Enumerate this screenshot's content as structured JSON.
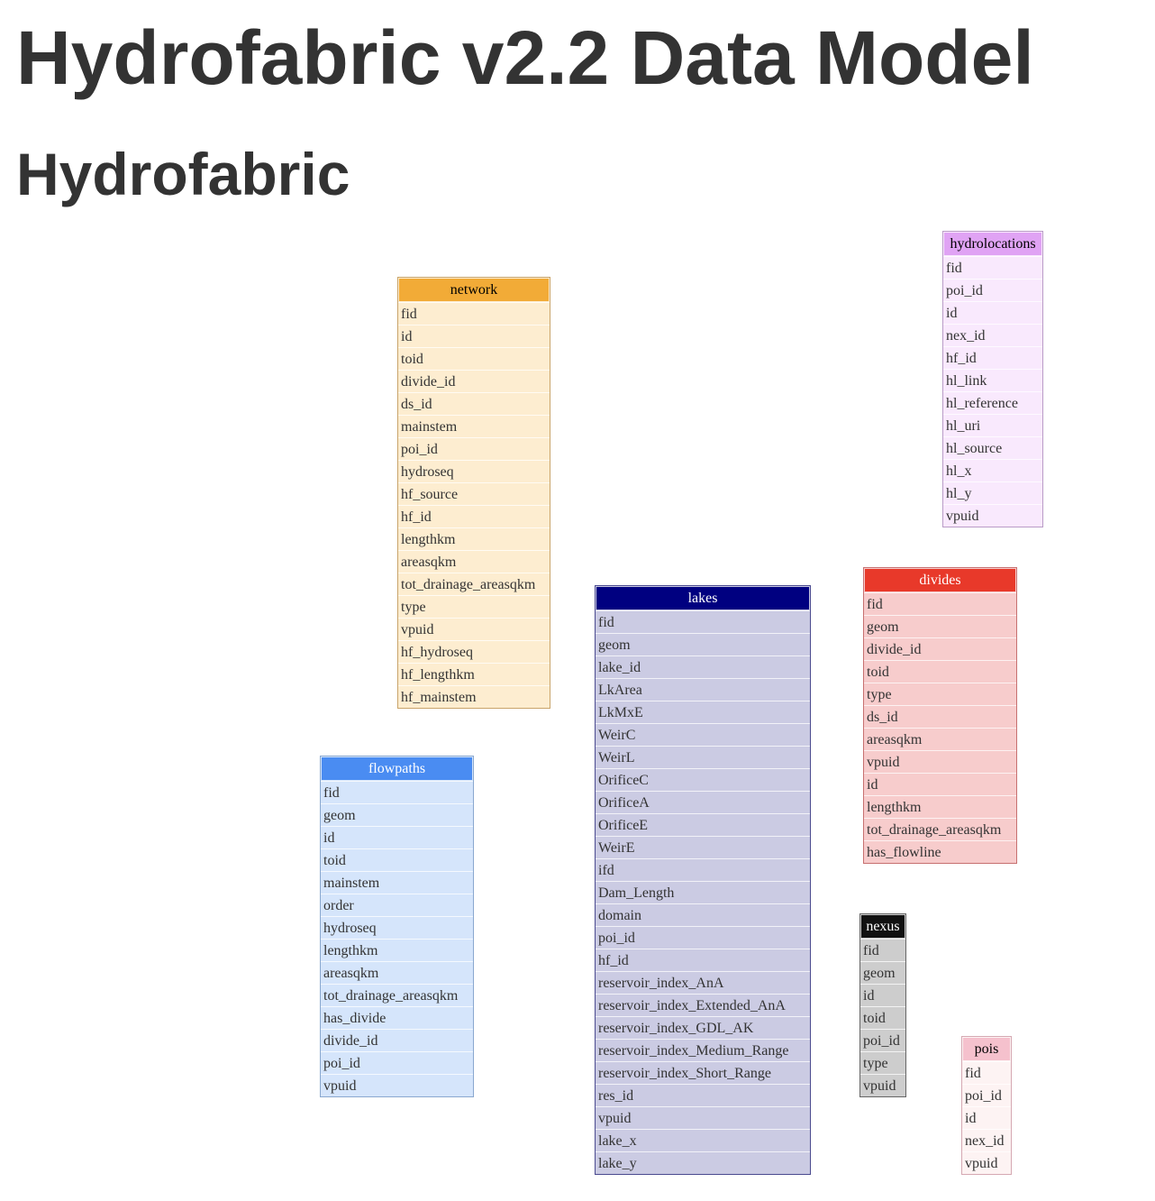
{
  "title": "Hydrofabric v2.2 Data Model",
  "subtitle": "Hydrofabric",
  "tables": {
    "network": {
      "name": "network",
      "colors": {
        "header": "#f2ab37",
        "header_text": "#000000",
        "body": "#fdedd0",
        "border": "#c9a46a"
      },
      "fields": [
        "fid",
        "id",
        "toid",
        "divide_id",
        "ds_id",
        "mainstem",
        "poi_id",
        "hydroseq",
        "hf_source",
        "hf_id",
        "lengthkm",
        "areasqkm",
        "tot_drainage_areasqkm",
        "type",
        "vpuid",
        "hf_hydroseq",
        "hf_lengthkm",
        "hf_mainstem"
      ]
    },
    "hydrolocations": {
      "name": "hydrolocations",
      "colors": {
        "header": "#e0a3f4",
        "header_text": "#000000",
        "body": "#f9e9fd",
        "border": "#b99bc7"
      },
      "fields": [
        "fid",
        "poi_id",
        "id",
        "nex_id",
        "hf_id",
        "hl_link",
        "hl_reference",
        "hl_uri",
        "hl_source",
        "hl_x",
        "hl_y",
        "vpuid"
      ]
    },
    "lakes": {
      "name": "lakes",
      "colors": {
        "header": "#000080",
        "header_text": "#ffffff",
        "body": "#cbcbe3",
        "border": "#4a4a8f"
      },
      "fields": [
        "fid",
        "geom",
        "lake_id",
        "LkArea",
        "LkMxE",
        "WeirC",
        "WeirL",
        "OrificeC",
        "OrificeA",
        "OrificeE",
        "WeirE",
        "ifd",
        "Dam_Length",
        "domain",
        "poi_id",
        "hf_id",
        "reservoir_index_AnA",
        "reservoir_index_Extended_AnA",
        "reservoir_index_GDL_AK",
        "reservoir_index_Medium_Range",
        "reservoir_index_Short_Range",
        "res_id",
        "vpuid",
        "lake_x",
        "lake_y"
      ]
    },
    "divides": {
      "name": "divides",
      "colors": {
        "header": "#e8392a",
        "header_text": "#ffffff",
        "body": "#f7cccc",
        "border": "#c77070"
      },
      "fields": [
        "fid",
        "geom",
        "divide_id",
        "toid",
        "type",
        "ds_id",
        "areasqkm",
        "vpuid",
        "id",
        "lengthkm",
        "tot_drainage_areasqkm",
        "has_flowline"
      ]
    },
    "flowpaths": {
      "name": "flowpaths",
      "colors": {
        "header": "#4a8cf2",
        "header_text": "#ffffff",
        "body": "#d5e5fb",
        "border": "#8aa8cf"
      },
      "fields": [
        "fid",
        "geom",
        "id",
        "toid",
        "mainstem",
        "order",
        "hydroseq",
        "lengthkm",
        "areasqkm",
        "tot_drainage_areasqkm",
        "has_divide",
        "divide_id",
        "poi_id",
        "vpuid"
      ]
    },
    "nexus": {
      "name": "nexus",
      "colors": {
        "header": "#111111",
        "header_text": "#ffffff",
        "body": "#cdcdcd",
        "border": "#666666"
      },
      "fields": [
        "fid",
        "geom",
        "id",
        "toid",
        "poi_id",
        "type",
        "vpuid"
      ]
    },
    "pois": {
      "name": "pois",
      "colors": {
        "header": "#f5c1cd",
        "header_text": "#000000",
        "body": "#fdf3f3",
        "border": "#d5a8b2"
      },
      "fields": [
        "fid",
        "poi_id",
        "id",
        "nex_id",
        "vpuid"
      ]
    }
  }
}
